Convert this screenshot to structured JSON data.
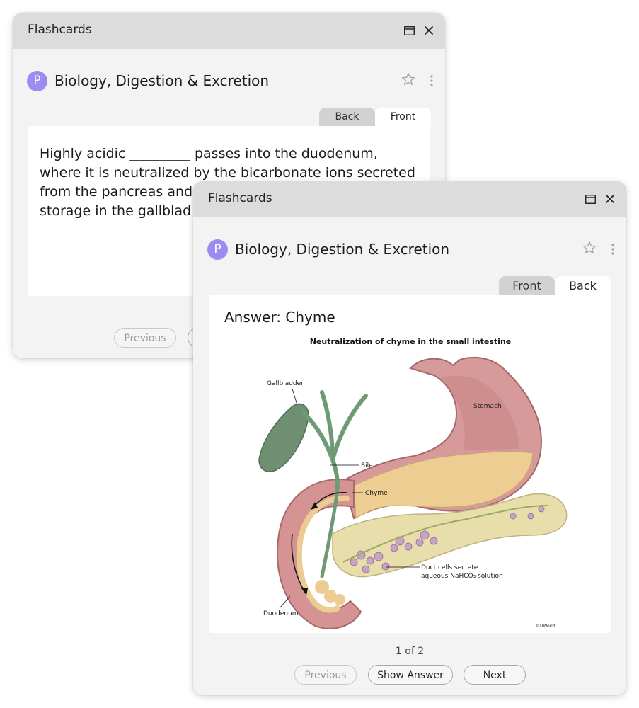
{
  "back_window": {
    "title": "Flashcards",
    "deck": {
      "avatar": "P",
      "name": "Biology, Digestion & Excretion"
    },
    "tabs": [
      {
        "label": "Back",
        "active": false
      },
      {
        "label": "Front",
        "active": true
      }
    ],
    "question_lines": [
      "Highly acidic _________ passes into the duodenum,",
      "where it is neutralized by the bicarbonate ions secreted",
      "from the pancreas and",
      "storage in the gallblad"
    ],
    "buttons": {
      "previous": "Previous"
    }
  },
  "front_window": {
    "title": "Flashcards",
    "deck": {
      "avatar": "P",
      "name": "Biology, Digestion & Excretion"
    },
    "tabs": [
      {
        "label": "Front",
        "active": false
      },
      {
        "label": "Back",
        "active": true
      }
    ],
    "answer": "Answer: Chyme",
    "figure": {
      "title": "Neutralization of chyme in the small intestine",
      "labels": {
        "gallbladder": "Gallbladder",
        "stomach": "Stomach",
        "bile": "Bile",
        "chyme": "Chyme",
        "duct_line1": "Duct cells secrete",
        "duct_line2": "aqueous NaHCO₃ solution",
        "duodenum": "Duodenum"
      },
      "credit": "©UWorld"
    },
    "counter": "1 of 2",
    "buttons": {
      "previous": "Previous",
      "show_answer": "Show Answer",
      "next": "Next"
    }
  },
  "colors": {
    "avatar": "#9b8cf2",
    "titlebar": "#dcdcdc",
    "window_bg": "#f3f3f3"
  },
  "icons": [
    "maximize-icon",
    "close-icon",
    "star-icon",
    "more-vertical-icon"
  ]
}
